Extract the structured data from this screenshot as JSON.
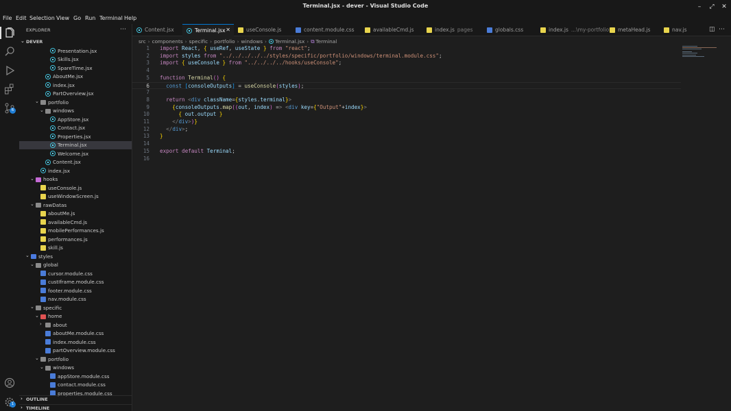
{
  "window": {
    "title": "Terminal.jsx - dever - Visual Studio Code"
  },
  "menu": [
    "File",
    "Edit",
    "Selection",
    "View",
    "Go",
    "Run",
    "Terminal",
    "Help"
  ],
  "activity": {
    "badge_source_control": "6",
    "badge_settings": "1"
  },
  "sidebar": {
    "header": "EXPLORER",
    "root": "DEVER",
    "outline": "OUTLINE",
    "timeline": "TIMELINE",
    "tree": [
      {
        "label": "Presentation.jsx",
        "icon": "react"
      },
      {
        "label": "Skills.jsx",
        "icon": "react"
      },
      {
        "label": "SpareTime.jsx",
        "icon": "react"
      },
      {
        "label": "AboutMe.jsx",
        "icon": "react"
      },
      {
        "label": "index.jsx",
        "icon": "react"
      },
      {
        "label": "PartOverview.jsx",
        "icon": "react"
      },
      {
        "label": "portfolio",
        "icon": "folder"
      },
      {
        "label": "windows",
        "icon": "folder"
      },
      {
        "label": "AppStore.jsx",
        "icon": "react"
      },
      {
        "label": "Contact.jsx",
        "icon": "react"
      },
      {
        "label": "Properties.jsx",
        "icon": "react"
      },
      {
        "label": "Terminal.jsx",
        "icon": "react"
      },
      {
        "label": "Welcome.jsx",
        "icon": "react"
      },
      {
        "label": "Content.jsx",
        "icon": "react"
      },
      {
        "label": "index.jsx",
        "icon": "react"
      },
      {
        "label": "hooks",
        "icon": "folder-hooks"
      },
      {
        "label": "useConsole.js",
        "icon": "js"
      },
      {
        "label": "useWindowScreen.js",
        "icon": "js"
      },
      {
        "label": "rawDatas",
        "icon": "folder"
      },
      {
        "label": "aboutMe.js",
        "icon": "js"
      },
      {
        "label": "availableCmd.js",
        "icon": "js"
      },
      {
        "label": "mobilePerformances.js",
        "icon": "js"
      },
      {
        "label": "performances.js",
        "icon": "js"
      },
      {
        "label": "skill.js",
        "icon": "js"
      },
      {
        "label": "styles",
        "icon": "folder-styles"
      },
      {
        "label": "global",
        "icon": "folder"
      },
      {
        "label": "cursor.module.css",
        "icon": "css"
      },
      {
        "label": "custIframe.module.css",
        "icon": "css"
      },
      {
        "label": "footer.module.css",
        "icon": "css"
      },
      {
        "label": "nav.module.css",
        "icon": "css"
      },
      {
        "label": "specific",
        "icon": "folder"
      },
      {
        "label": "home",
        "icon": "folder-home"
      },
      {
        "label": "about",
        "icon": "folder"
      },
      {
        "label": "aboutMe.module.css",
        "icon": "css"
      },
      {
        "label": "index.module.css",
        "icon": "css"
      },
      {
        "label": "partOverview.module.css",
        "icon": "css"
      },
      {
        "label": "portfolio",
        "icon": "folder"
      },
      {
        "label": "windows",
        "icon": "folder"
      },
      {
        "label": "appStore.module.css",
        "icon": "css"
      },
      {
        "label": "contact.module.css",
        "icon": "css"
      },
      {
        "label": "properties.module.css",
        "icon": "css"
      }
    ]
  },
  "tabs": [
    {
      "label": "Content.jsx",
      "icon": "react",
      "hint": ""
    },
    {
      "label": "Terminal.jsx",
      "icon": "react",
      "hint": ""
    },
    {
      "label": "useConsole.js",
      "icon": "js",
      "hint": ""
    },
    {
      "label": "content.module.css",
      "icon": "css",
      "hint": ""
    },
    {
      "label": "availableCmd.js",
      "icon": "js",
      "hint": ""
    },
    {
      "label": "index.js",
      "icon": "js",
      "hint": "pages"
    },
    {
      "label": "globals.css",
      "icon": "css",
      "hint": ""
    },
    {
      "label": "index.js",
      "icon": "js",
      "hint": "...\\my-portfolio"
    },
    {
      "label": "metaHead.js",
      "icon": "js",
      "hint": ""
    },
    {
      "label": "nav.js",
      "icon": "js",
      "hint": ""
    }
  ],
  "breadcrumb": [
    "src",
    "components",
    "specific",
    "portfolio",
    "windows",
    "Terminal.jsx",
    "Terminal"
  ],
  "editor": {
    "line_numbers": [
      "1",
      "2",
      "3",
      "4",
      "5",
      "6",
      "7",
      "8",
      "9",
      "10",
      "11",
      "12",
      "13",
      "14",
      "15",
      "16"
    ],
    "lines": [
      "import React, { useRef, useState } from \"react\";",
      "import styles from \"../../../../../styles/specific/portfolio/windows/terminal.module.css\";",
      "import { useConsole } from \"../../../../hooks/useConsole\";",
      "",
      "function Terminal() {",
      "  const [consoleOutputs] = useConsole(styles);",
      "",
      "  return <div className={styles.terminal}>",
      "    {consoleOutputs.map((out, index) => <div key={\"Output\"+index}>",
      "      { out.output }",
      "    </div>)}",
      "  </div>;",
      "}",
      "",
      "export default Terminal;",
      ""
    ]
  }
}
